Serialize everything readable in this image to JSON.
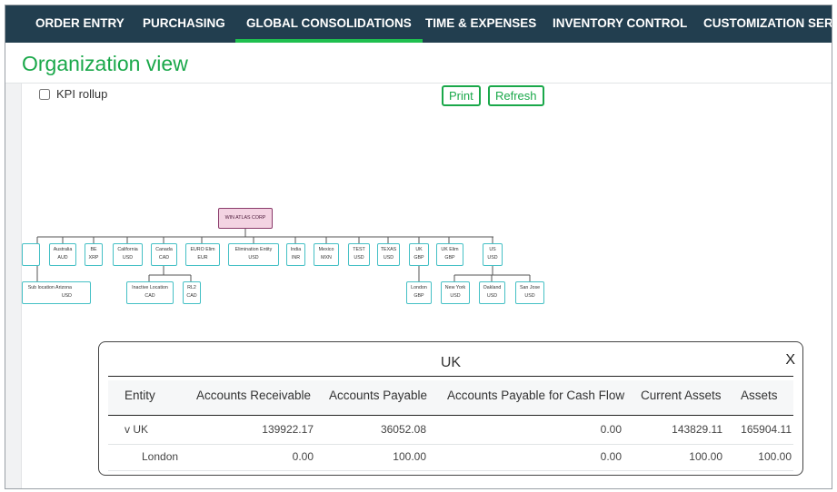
{
  "nav": {
    "items": [
      {
        "label": "ORDER ENTRY"
      },
      {
        "label": "PURCHASING"
      },
      {
        "label": "GLOBAL CONSOLIDATIONS",
        "active": true
      },
      {
        "label": "TIME & EXPENSES"
      },
      {
        "label": "INVENTORY CONTROL"
      },
      {
        "label": "CUSTOMIZATION SERV"
      }
    ],
    "colors": {
      "background": "#223e4f",
      "active_underline": "#1fbf4f"
    }
  },
  "page": {
    "title": "Organization view",
    "accent": "#1aa84a"
  },
  "controls": {
    "kpi_rollup_label": "KPI rollup",
    "kpi_rollup_checked": false,
    "print_label": "Print",
    "refresh_label": "Refresh"
  },
  "org_chart": {
    "root": {
      "name": "WIN ATLAS CORP"
    },
    "level1": [
      {
        "name": "",
        "currency": ""
      },
      {
        "name": "Australia",
        "currency": "AUD"
      },
      {
        "name": "BE",
        "currency": "XRP"
      },
      {
        "name": "California",
        "currency": "USD"
      },
      {
        "name": "Canada",
        "currency": "CAD"
      },
      {
        "name": "EURO Elim",
        "currency": "EUR"
      },
      {
        "name": "Elimination Entity",
        "currency": "USD"
      },
      {
        "name": "India",
        "currency": "INR"
      },
      {
        "name": "Mexico",
        "currency": "MXN"
      },
      {
        "name": "TEST",
        "currency": "USD"
      },
      {
        "name": "TEXAS",
        "currency": "USD"
      },
      {
        "name": "UK",
        "currency": "GBP"
      },
      {
        "name": "UK Elim",
        "currency": "GBP"
      },
      {
        "name": "US",
        "currency": "USD"
      }
    ],
    "level2": [
      {
        "name": "Sub location Arizona",
        "currency": "USD"
      },
      {
        "name": "Inactive Location",
        "currency": "CAD"
      },
      {
        "name": "RL2",
        "currency": "CAD"
      },
      {
        "name": "London",
        "currency": "GBP"
      },
      {
        "name": "New York",
        "currency": "USD"
      },
      {
        "name": "Oakland",
        "currency": "USD"
      },
      {
        "name": "San Jose",
        "currency": "USD"
      }
    ]
  },
  "modal": {
    "title": "UK",
    "close_label": "X",
    "columns": [
      "Entity",
      "Accounts Receivable",
      "Accounts Payable",
      "Accounts Payable for Cash Flow",
      "Current Assets",
      "Assets"
    ],
    "rows": [
      {
        "entity": "v UK",
        "ar": "139922.17",
        "ap": "36052.08",
        "apcf": "0.00",
        "current_assets": "143829.11",
        "assets": "165904.11"
      },
      {
        "entity": "London",
        "ar": "0.00",
        "ap": "100.00",
        "apcf": "0.00",
        "current_assets": "100.00",
        "assets": "100.00"
      }
    ]
  }
}
